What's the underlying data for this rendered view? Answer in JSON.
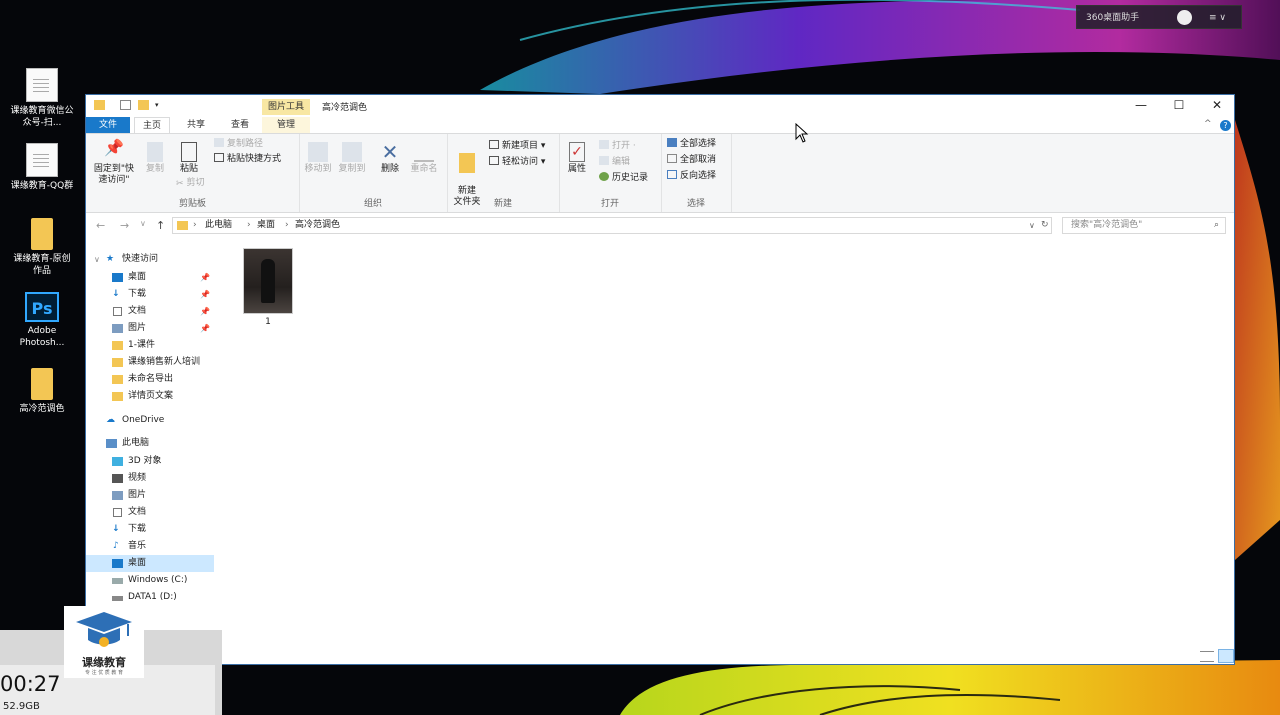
{
  "desktop": {
    "icons": [
      {
        "label": "课缘教育微信公众号-扫...",
        "type": "doc"
      },
      {
        "label": "课缘教育-QQ群",
        "type": "doc"
      },
      {
        "label": "课缘教育-原创作品",
        "type": "folder"
      },
      {
        "label": "Adobe Photosh...",
        "type": "ps",
        "glyph": "Ps"
      },
      {
        "label": "高冷范调色",
        "type": "folder"
      }
    ]
  },
  "assistant_widget": {
    "label": "360桌面助手",
    "menu_icon": "≡ ∨"
  },
  "window": {
    "title": "高冷范调色",
    "context_tab": "图片工具",
    "controls": {
      "minimize": "—",
      "maximize": "☐",
      "close": "✕"
    },
    "ribbon_tabs": {
      "file": "文件",
      "home": "主页",
      "share": "共享",
      "view": "查看",
      "manage": "管理"
    },
    "ribbon": {
      "clipboard": {
        "label": "剪贴板",
        "pin": "固定到\"快速访问\"",
        "copy": "复制",
        "paste": "粘贴",
        "copy_path": "复制路径",
        "paste_shortcut": "粘贴快捷方式",
        "cut": "剪切"
      },
      "organize": {
        "label": "组织",
        "move_to": "移动到",
        "copy_to": "复制到",
        "delete": "删除",
        "rename": "重命名"
      },
      "new": {
        "label": "新建",
        "new_folder": "新建\n文件夹",
        "new_item": "新建项目 ▾",
        "easy_access": "轻松访问 ▾"
      },
      "open": {
        "label": "打开",
        "properties": "属性",
        "open": "打开 ·",
        "edit": "编辑",
        "history": "历史记录"
      },
      "select": {
        "label": "选择",
        "select_all": "全部选择",
        "select_none": "全部取消",
        "invert": "反向选择"
      }
    },
    "address": {
      "crumbs": [
        "此电脑",
        "桌面",
        "高冷范调色"
      ],
      "search_placeholder": "搜索\"高冷范调色\""
    },
    "nav": {
      "quick_access": "快速访问",
      "quick_items": [
        {
          "label": "桌面",
          "pinned": true
        },
        {
          "label": "下载",
          "pinned": true
        },
        {
          "label": "文档",
          "pinned": true
        },
        {
          "label": "图片",
          "pinned": true
        },
        {
          "label": "1-课件",
          "pinned": false
        },
        {
          "label": "课缘销售新人培训",
          "pinned": false
        },
        {
          "label": "未命名导出",
          "pinned": false
        },
        {
          "label": "详情页文案",
          "pinned": false
        }
      ],
      "onedrive": "OneDrive",
      "this_pc": "此电脑",
      "pc_items": [
        {
          "label": "3D 对象"
        },
        {
          "label": "视频"
        },
        {
          "label": "图片"
        },
        {
          "label": "文档"
        },
        {
          "label": "下载"
        },
        {
          "label": "音乐"
        },
        {
          "label": "桌面",
          "selected": true
        },
        {
          "label": "Windows (C:)"
        },
        {
          "label": "DATA1 (D:)"
        }
      ]
    },
    "files": [
      {
        "name": "1"
      }
    ]
  },
  "overlay": {
    "logo_name": "课缘教育",
    "logo_sub": "专 注 优 质 教 育",
    "clock": "00:27",
    "disk": "52.9GB"
  },
  "colors": {
    "accent": "#1979ca",
    "selection": "#cce8ff",
    "folder": "#f3c654",
    "context_tab": "#f8e7a3"
  }
}
